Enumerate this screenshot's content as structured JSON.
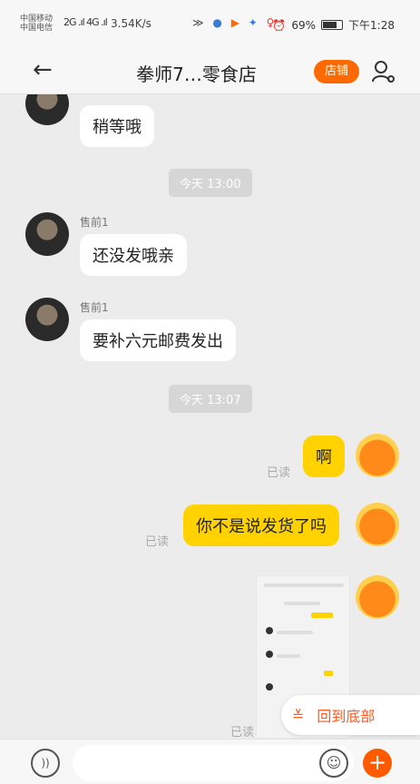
{
  "status_bar": {
    "carrier1": "中国移动",
    "carrier2": "中国电信",
    "signal": "2G .ıl 4G .ıl",
    "speed": "3.54K/s",
    "battery": "69%",
    "time": "下午1:28"
  },
  "header": {
    "back_icon": "arrow-left",
    "title": "拳师7…零食店",
    "shop_button": "店铺",
    "user_icon": "user-settings"
  },
  "messages": [
    {
      "from": "seller",
      "text": "稍等哦"
    },
    {
      "type": "time",
      "text": "今天  13:00"
    },
    {
      "from": "seller",
      "sender": "售前1",
      "text": "还没发哦亲"
    },
    {
      "from": "seller",
      "sender": "售前1",
      "text": "要补六元邮费发出"
    },
    {
      "type": "time",
      "text": "今天  13:07"
    },
    {
      "from": "me",
      "read": "已读",
      "text": "啊"
    },
    {
      "from": "me",
      "read": "已读",
      "text": "你不是说发货了吗"
    },
    {
      "from": "me",
      "read": "已读",
      "type": "image"
    }
  ],
  "back_to_bottom": "回到底部",
  "input": {
    "voice_label": "))"
  },
  "colors": {
    "accent": "#ff6a00",
    "my_bubble": "#ffd200",
    "background": "#ececec"
  }
}
